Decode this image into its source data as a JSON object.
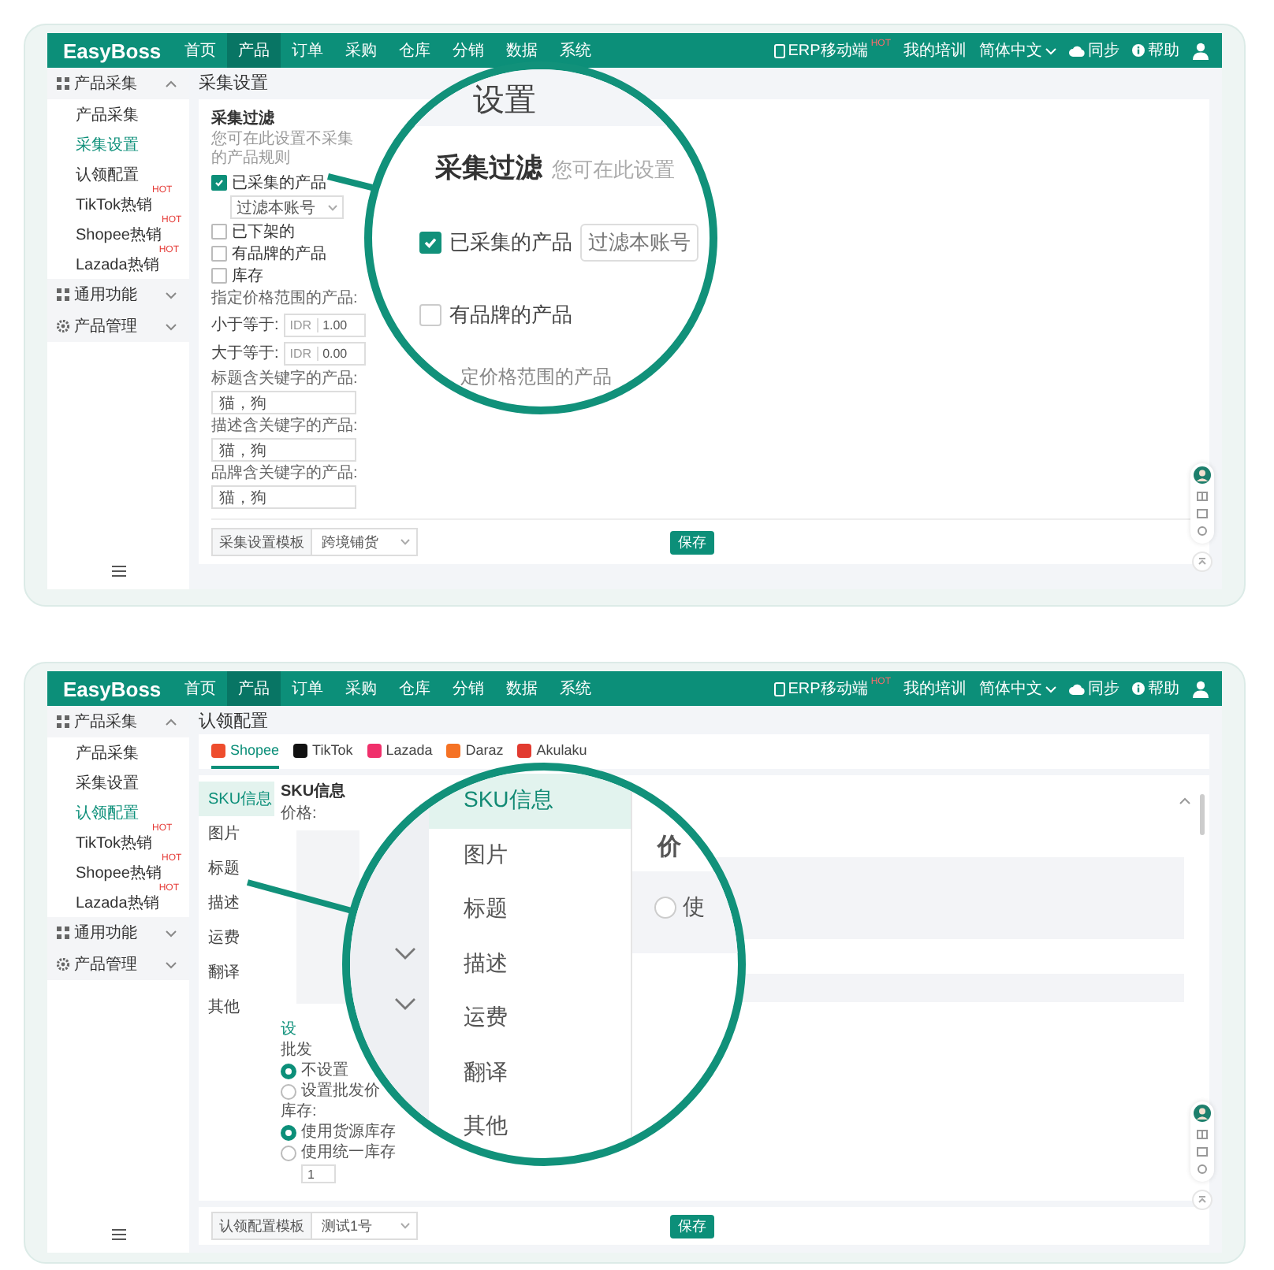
{
  "screens": [
    {
      "kind": "collect",
      "logo": "EasyBoss",
      "nav": [
        {
          "label": "首页",
          "selected": false
        },
        {
          "label": "产品",
          "selected": true
        },
        {
          "label": "订单",
          "selected": false
        },
        {
          "label": "采购",
          "selected": false
        },
        {
          "label": "仓库",
          "selected": false
        },
        {
          "label": "分销",
          "selected": false
        },
        {
          "label": "数据",
          "selected": false
        },
        {
          "label": "系统",
          "selected": false
        }
      ],
      "links": [
        {
          "kind": "mobile",
          "label": "ERP移动端",
          "badge": "HOT"
        },
        {
          "kind": "plain",
          "label": "我的培训"
        },
        {
          "kind": "language",
          "label": "简体中文"
        },
        {
          "kind": "sync",
          "label": "同步"
        },
        {
          "kind": "help",
          "label": "帮助"
        }
      ],
      "sidebar": [
        {
          "kind": "grid",
          "label": "产品采集",
          "expanded": true,
          "children": [
            {
              "label": "产品采集",
              "selected": false
            },
            {
              "label": "采集设置",
              "selected": true
            },
            {
              "label": "认领配置",
              "selected": false
            },
            {
              "label": "TikTok热销",
              "selected": false,
              "badge": "HOT"
            },
            {
              "label": "Shopee热销",
              "selected": false,
              "badge": "HOT"
            },
            {
              "label": "Lazada热销",
              "selected": false,
              "badge": "HOT"
            }
          ]
        },
        {
          "kind": "grid",
          "label": "通用功能",
          "expanded": false
        },
        {
          "kind": "gear",
          "label": "产品管理",
          "expanded": false
        }
      ],
      "page_title": "采集设置",
      "filter": {
        "title": "采集过滤",
        "hint": "您可在此设置不采集的产品规则",
        "options": [
          {
            "label": "已采集的产品",
            "checked": true,
            "select": "过滤本账号"
          },
          {
            "label": "已下架的",
            "checked": false
          },
          {
            "label": "有品牌的产品",
            "checked": false
          },
          {
            "label": "库存",
            "checked": false
          }
        ],
        "price_label": "指定价格范围的产品:",
        "price_rows": [
          {
            "label": "小于等于:",
            "currency": "IDR",
            "value": "1.00"
          },
          {
            "label": "大于等于:",
            "currency": "IDR",
            "value": "0.00"
          }
        ],
        "keyword_fields": [
          {
            "label": "标题含关键字的产品:",
            "value": "猫，狗"
          },
          {
            "label": "描述含关键字的产品:",
            "value": "猫，狗"
          },
          {
            "label": "品牌含关键字的产品:",
            "value": "猫，狗"
          }
        ]
      },
      "footer": {
        "template_label": "采集设置模板",
        "template_value": "跨境铺货",
        "save": "保存"
      },
      "magnifier": {
        "heading": "设置",
        "title": "采集过滤",
        "hint": "您可在此设置",
        "options": [
          {
            "label": "已采集的产品",
            "checked": true,
            "select": "过滤本账号"
          },
          {
            "label": "有品牌的产品",
            "checked": false
          }
        ],
        "price_label": "定价格范围的产品"
      }
    },
    {
      "kind": "claim",
      "logo": "EasyBoss",
      "nav": [
        {
          "label": "首页",
          "selected": false
        },
        {
          "label": "产品",
          "selected": true
        },
        {
          "label": "订单",
          "selected": false
        },
        {
          "label": "采购",
          "selected": false
        },
        {
          "label": "仓库",
          "selected": false
        },
        {
          "label": "分销",
          "selected": false
        },
        {
          "label": "数据",
          "selected": false
        },
        {
          "label": "系统",
          "selected": false
        }
      ],
      "links": [
        {
          "kind": "mobile",
          "label": "ERP移动端",
          "badge": "HOT"
        },
        {
          "kind": "plain",
          "label": "我的培训"
        },
        {
          "kind": "language",
          "label": "简体中文"
        },
        {
          "kind": "sync",
          "label": "同步"
        },
        {
          "kind": "help",
          "label": "帮助"
        }
      ],
      "sidebar": [
        {
          "kind": "grid",
          "label": "产品采集",
          "expanded": true,
          "children": [
            {
              "label": "产品采集",
              "selected": false
            },
            {
              "label": "采集设置",
              "selected": false
            },
            {
              "label": "认领配置",
              "selected": true
            },
            {
              "label": "TikTok热销",
              "selected": false,
              "badge": "HOT"
            },
            {
              "label": "Shopee热销",
              "selected": false,
              "badge": "HOT"
            },
            {
              "label": "Lazada热销",
              "selected": false,
              "badge": "HOT"
            }
          ]
        },
        {
          "kind": "grid",
          "label": "通用功能",
          "expanded": false
        },
        {
          "kind": "gear",
          "label": "产品管理",
          "expanded": false
        }
      ],
      "page_title": "认领配置",
      "platforms": [
        {
          "label": "Shopee",
          "selected": true,
          "color": "#ee4d2d"
        },
        {
          "label": "TikTok",
          "selected": false,
          "color": "#111111"
        },
        {
          "label": "Lazada",
          "selected": false,
          "color": "#f0306b"
        },
        {
          "label": "Daraz",
          "selected": false,
          "color": "#f57224"
        },
        {
          "label": "Akulaku",
          "selected": false,
          "color": "#e23b30"
        }
      ],
      "menu": [
        {
          "label": "SKU信息",
          "selected": true
        },
        {
          "label": "图片",
          "selected": false
        },
        {
          "label": "标题",
          "selected": false
        },
        {
          "label": "描述",
          "selected": false
        },
        {
          "label": "运费",
          "selected": false
        },
        {
          "label": "翻译",
          "selected": false
        },
        {
          "label": "其他",
          "selected": false
        }
      ],
      "sku": {
        "title": "SKU信息",
        "price_label": "价格:",
        "wholesale_title": "设",
        "wholesale_label": "批发",
        "wholesale_options": [
          {
            "label": "不设置",
            "selected": true
          },
          {
            "label": "设置批发价",
            "selected": false
          }
        ],
        "stock_label": "库存:",
        "stock_options": [
          {
            "label": "使用货源库存",
            "selected": true
          },
          {
            "label": "使用统一库存",
            "selected": false,
            "value": "1"
          }
        ]
      },
      "footer": {
        "template_label": "认领配置模板",
        "template_value": "测试1号",
        "save": "保存"
      },
      "magnifier": {
        "menu": [
          {
            "label": "SKU信息",
            "selected": true
          },
          {
            "label": "图片",
            "selected": false
          },
          {
            "label": "标题",
            "selected": false
          },
          {
            "label": "描述",
            "selected": false
          },
          {
            "label": "运费",
            "selected": false
          },
          {
            "label": "翻译",
            "selected": false
          },
          {
            "label": "其他",
            "selected": false
          }
        ],
        "price_label": "价",
        "option": {
          "label": "使",
          "selected": false
        }
      }
    }
  ]
}
